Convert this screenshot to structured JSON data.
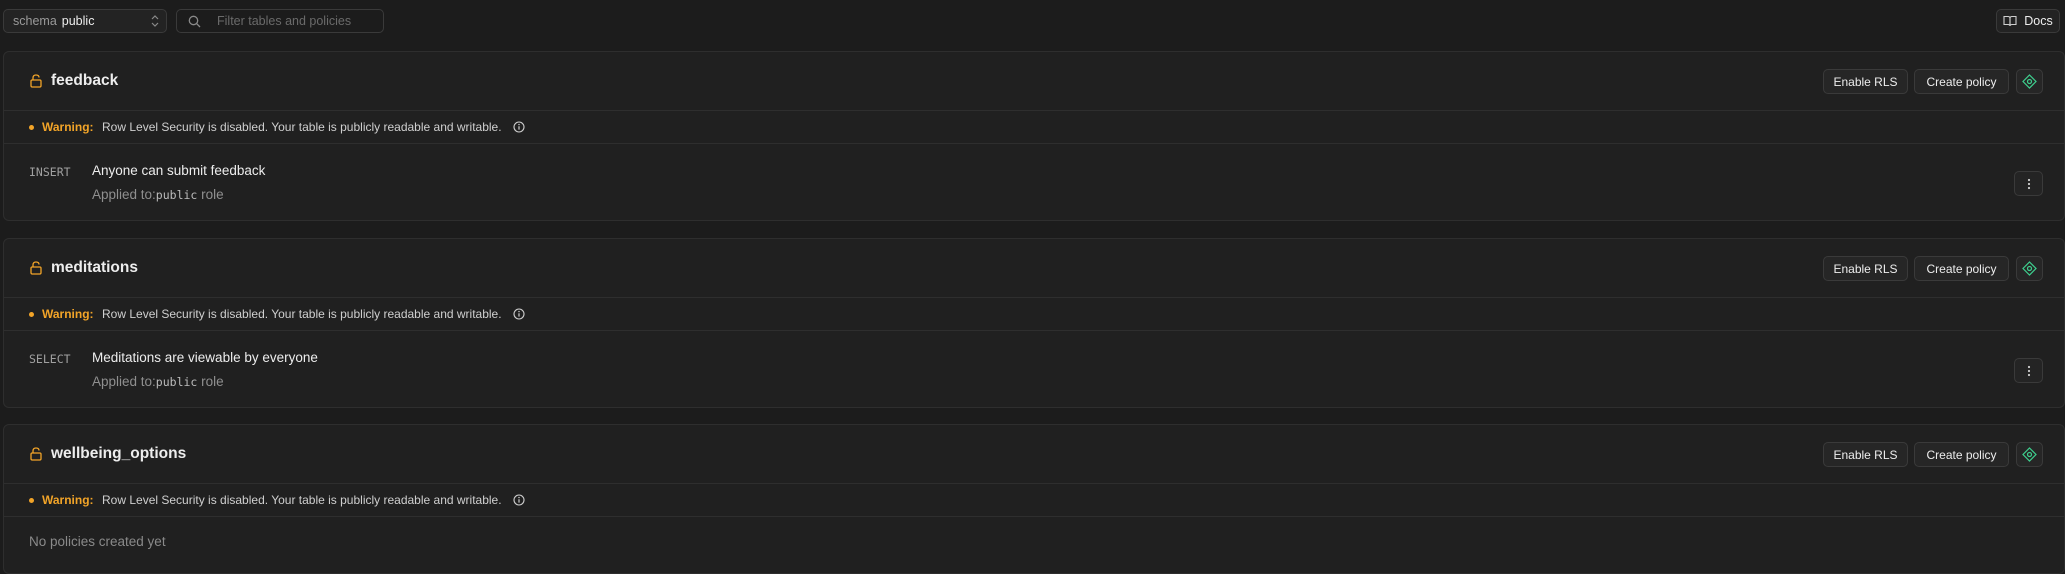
{
  "toolbar": {
    "schema_label": "schema",
    "schema_value": "public",
    "search_placeholder": "Filter tables and policies",
    "docs_label": "Docs"
  },
  "colors": {
    "warning": "#f2a428",
    "background": "#1c1c1c",
    "card": "#202020",
    "border": "#2e2e2e"
  },
  "tables": [
    {
      "name": "feedback",
      "enable_rls_label": "Enable RLS",
      "create_policy_label": "Create policy",
      "warning_label": "Warning:",
      "warning_text": "Row Level Security is disabled. Your table is publicly readable and writable.",
      "policy": {
        "command": "INSERT",
        "name": "Anyone can submit feedback",
        "applied_prefix": "Applied to:",
        "role": "public",
        "role_suffix": "role"
      }
    },
    {
      "name": "meditations",
      "enable_rls_label": "Enable RLS",
      "create_policy_label": "Create policy",
      "warning_label": "Warning:",
      "warning_text": "Row Level Security is disabled. Your table is publicly readable and writable.",
      "policy": {
        "command": "SELECT",
        "name": "Meditations are viewable by everyone",
        "applied_prefix": "Applied to:",
        "role": "public",
        "role_suffix": "role"
      }
    },
    {
      "name": "wellbeing_options",
      "enable_rls_label": "Enable RLS",
      "create_policy_label": "Create policy",
      "warning_label": "Warning:",
      "warning_text": "Row Level Security is disabled. Your table is publicly readable and writable.",
      "empty_text": "No policies created yet"
    }
  ]
}
